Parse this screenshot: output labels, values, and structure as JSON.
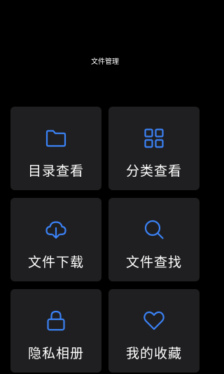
{
  "header": {
    "title": "文件管理"
  },
  "tiles": [
    {
      "label": "目录查看",
      "icon": "folder-icon"
    },
    {
      "label": "分类查看",
      "icon": "grid-icon"
    },
    {
      "label": "文件下载",
      "icon": "cloud-download-icon"
    },
    {
      "label": "文件查找",
      "icon": "search-icon"
    },
    {
      "label": "隐私相册",
      "icon": "lock-icon"
    },
    {
      "label": "我的收藏",
      "icon": "heart-icon"
    }
  ],
  "colors": {
    "background": "#000000",
    "tile": "#1f1f21",
    "accent": "#3b82f6",
    "text": "#ffffff"
  }
}
